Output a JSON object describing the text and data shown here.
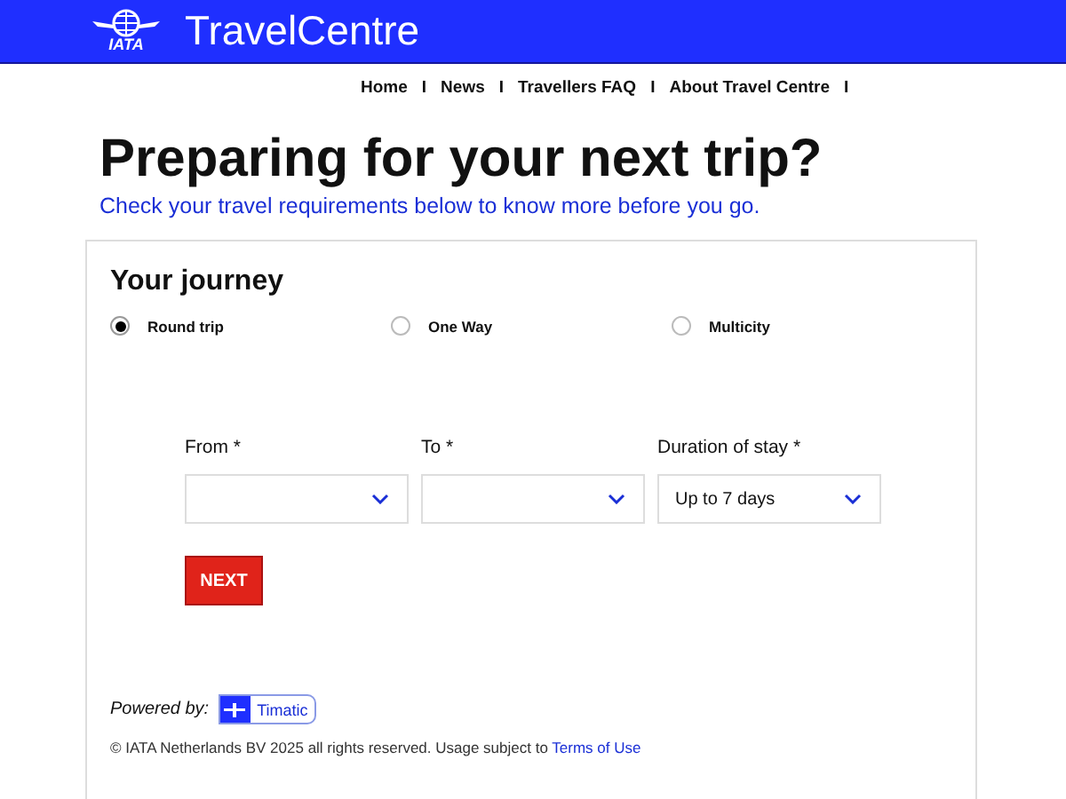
{
  "header": {
    "logo_text": "IATA",
    "title": "TravelCentre"
  },
  "nav": [
    {
      "label": "Home",
      "separator": "I"
    },
    {
      "label": "News",
      "separator": "I"
    },
    {
      "label": "Travellers FAQ",
      "separator": "I"
    },
    {
      "label": "About Travel Centre",
      "separator": "I"
    }
  ],
  "heading": "Preparing for your next trip?",
  "subtitle": "Check your travel requirements below to know more before you go.",
  "journey": {
    "title": "Your journey",
    "trip_types": [
      {
        "label": "Round trip",
        "selected": true
      },
      {
        "label": "One Way",
        "selected": false
      },
      {
        "label": "Multicity",
        "selected": false
      }
    ],
    "fields": [
      {
        "label": "From *"
      },
      {
        "label": "To *"
      },
      {
        "label": "Duration of stay *",
        "value": "Up to 7 days"
      }
    ],
    "button": "NEXT"
  },
  "footer": {
    "powered_by": "Powered by:",
    "badge": "Timatic",
    "copyright": "© IATA Netherlands BV 2025 all rights reserved. Usage subject to",
    "terms_link": "Terms of Use"
  }
}
